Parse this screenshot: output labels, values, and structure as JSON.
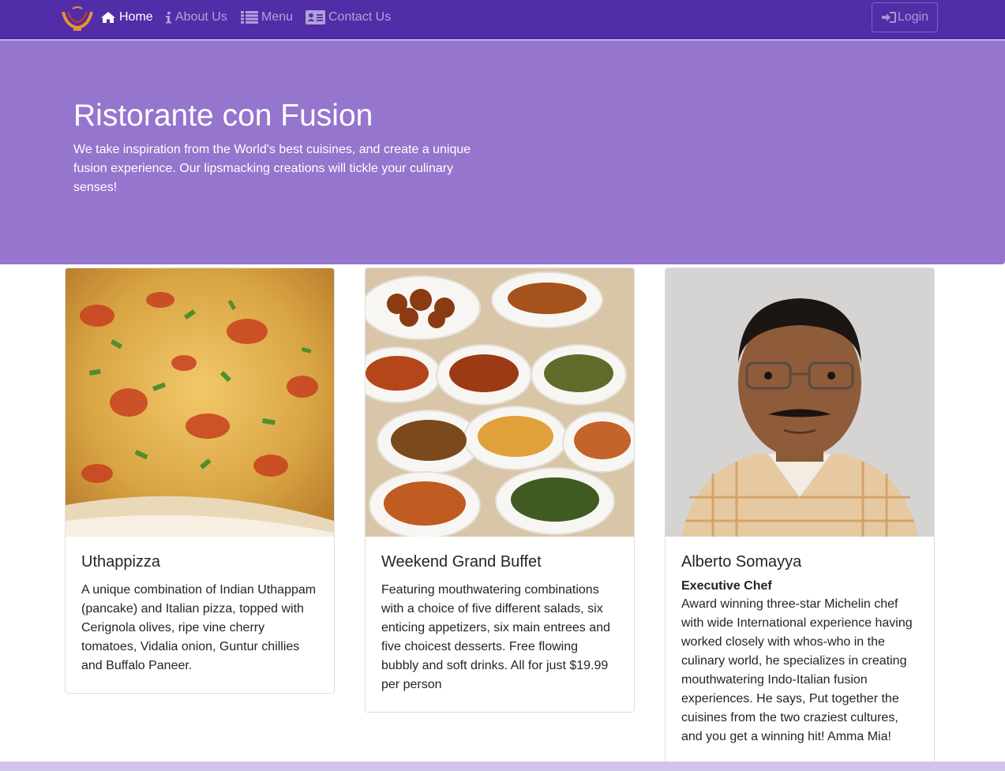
{
  "nav": {
    "logo_icon": "ristorante-logo-icon",
    "items": [
      {
        "label": "Home",
        "icon": "home-icon"
      },
      {
        "label": "About Us",
        "icon": "info-icon"
      },
      {
        "label": "Menu",
        "icon": "list-icon"
      },
      {
        "label": "Contact Us",
        "icon": "address-card-icon"
      }
    ],
    "login_label": "Login",
    "login_icon": "sign-in-icon"
  },
  "jumbotron": {
    "title": "Ristorante con Fusion",
    "text": "We take inspiration from the World's best cuisines, and create a unique fusion experience. Our lipsmacking creations will tickle your culinary senses!"
  },
  "cards": [
    {
      "title": "Uthappizza",
      "text": "A unique combination of Indian Uthappam (pancake) and Italian pizza, topped with Cerignola olives, ripe vine cherry tomatoes, Vidalia onion, Guntur chillies and Buffalo Paneer."
    },
    {
      "title": "Weekend Grand Buffet",
      "text": "Featuring mouthwatering combinations with a choice of five different salads, six enticing appetizers, six main entrees and five choicest desserts. Free flowing bubbly and soft drinks. All for just $19.99 per person"
    },
    {
      "title": "Alberto Somayya",
      "subtitle": "Executive Chef",
      "text": "Award winning three-star Michelin chef with wide International experience having worked closely with whos-who in the culinary world, he specializes in creating mouthwatering Indo-Italian fusion experiences. He says, Put together the cuisines from the two craziest cultures, and you get a winning hit! Amma Mia!"
    }
  ],
  "colors": {
    "navbar": "#512DA8",
    "jumbotron": "#9575CD",
    "footer": "#D1C4E9"
  }
}
